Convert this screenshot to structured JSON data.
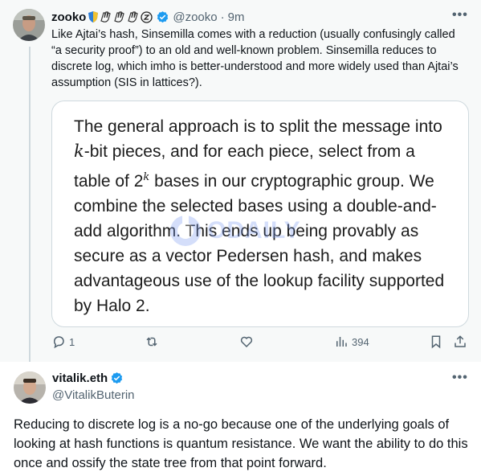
{
  "tweet1": {
    "author_name": "zooko",
    "handle": "@zooko",
    "separator": "·",
    "time": "9m",
    "text": "Like Ajtai’s hash, Sinsemilla comes with a reduction (usually confusingly called “a security proof”) to an old and well-known problem. Sinsemilla reduces to discrete log, which imho is better-understood and more widely used than Ajtai’s assumption (SIS in lattices?).",
    "more_icon": "•••",
    "quote": {
      "part1": "The general approach is to split the message into ",
      "var_k": "k",
      "part2": "-bit pieces, and for each piece, select from a table of ",
      "base": "2",
      "exp": "k",
      "part3": " bases in our cryptographic group. We combine the selected bases using a double-and-add algorithm. This ends up being provably as secure as a vector Pedersen hash, and makes advantageous use of the lookup facility supported by Halo 2."
    },
    "watermark_text": "ODAILY",
    "actions": {
      "reply_count": "1",
      "retweet_count": "",
      "like_count": "",
      "views_count": "394"
    }
  },
  "tweet2": {
    "author_name": "vitalik.eth",
    "handle": "@VitalikButerin",
    "more_icon": "•••",
    "text": "Reducing to discrete log is a no-go because one of the underlying goals of looking at hash functions is quantum resistance. We want the ability to do this once and ossify the state tree from that point forward."
  },
  "colors": {
    "verified_blue": "#1d9bf0",
    "muted_gray": "#536471",
    "thread_background": "#f7f9f9"
  }
}
